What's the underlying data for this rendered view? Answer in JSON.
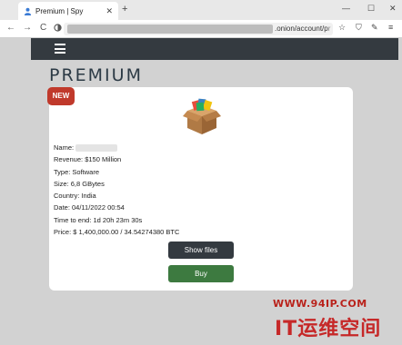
{
  "browser": {
    "tab_title": "Premium | Spy",
    "tab_close": "✕",
    "new_tab": "+",
    "window_controls": [
      "—",
      "☐",
      "✕"
    ],
    "nav_buttons": [
      "←",
      "→",
      "C"
    ],
    "url_visible": ".onion/account/p",
    "url_dim": "r",
    "toolbar_icons": [
      "☆",
      "⛉",
      "✎",
      "≡"
    ]
  },
  "site": {
    "page_title": "PREMIUM",
    "badge": "NEW"
  },
  "listing": {
    "name_label": "Name:",
    "revenue": "Revenue:  $150 Million",
    "type": "Type:  Software",
    "size": "Size:  6,8 GBytes",
    "country": "Country:  India",
    "date": "Date:  04/11/2022 00:54",
    "time_to_end": "Time to end:  1d 20h 23m 30s",
    "price": "Price:  $ 1,400,000.00 / 34.54274380 BTC"
  },
  "actions": {
    "show_files": "Show files",
    "buy": "Buy"
  },
  "watermark": {
    "url": "WWW.94IP.COM",
    "logo": "IT运维空间"
  },
  "colors": {
    "nav_bg": "#343a40",
    "badge_red": "#c0392b",
    "buy_green": "#3d7a40",
    "page_bg": "#d2d2d2"
  },
  "icons": [
    "profile-icon",
    "hamburger-menu-icon",
    "package-box-icon"
  ]
}
